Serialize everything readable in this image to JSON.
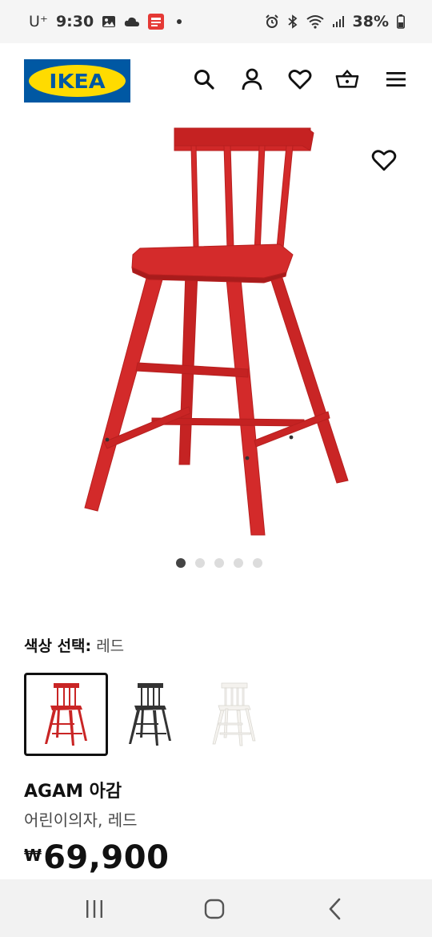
{
  "status_bar": {
    "carrier": "U⁺",
    "time": "9:30",
    "battery": "38%"
  },
  "header": {
    "logo_text": "IKEA",
    "icons": [
      "search-icon",
      "account-icon",
      "heart-icon",
      "cart-icon",
      "menu-icon"
    ]
  },
  "gallery": {
    "image_count": 5,
    "active_index": 0,
    "product_color_hex": "#d32a2a"
  },
  "color_selector": {
    "label": "색상 선택:",
    "selected_value": "레드",
    "options": [
      {
        "name": "레드",
        "hex": "#d32a2a"
      },
      {
        "name": "블랙",
        "hex": "#333333"
      },
      {
        "name": "화이트",
        "hex": "#f4f2ee"
      }
    ]
  },
  "product": {
    "name": "AGAM 아감",
    "description": "어린이의자, 레드",
    "currency": "₩",
    "price": "69,900"
  }
}
